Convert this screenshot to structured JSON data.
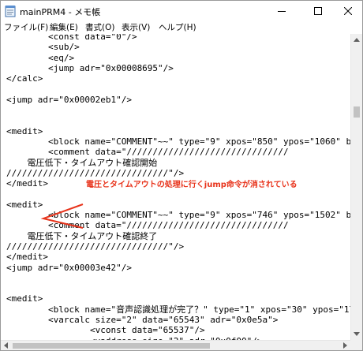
{
  "window": {
    "title": "mainPRM4 - メモ帳"
  },
  "title_buttons": {
    "minimize_icon": "minimize-icon",
    "maximize_icon": "maximize-icon",
    "close_icon": "close-icon"
  },
  "menu": {
    "items": [
      {
        "label": "ファイル(F)"
      },
      {
        "label": "編集(E)"
      },
      {
        "label": "書式(O)"
      },
      {
        "label": "表示(V)"
      },
      {
        "label": "ヘルプ(H)"
      }
    ]
  },
  "editor": {
    "content": "        <const data=\"0\"/>\n        <sub/>\n        <eq/>\n        <jump adr=\"0x00008695\"/>\n</calc>\n\n<jump adr=\"0x00002eb1\"/>\n\n\n<medit>\n        <block name=\"COMMENT\"~~\" type=\"9\" xpos=\"850\" ypos=\"1060\" bluearrow\n        <comment data=\"///////////////////////////////\n    電圧低下・タイムアウト確認開始\n///////////////////////////////\"/>\n</medit>\n\n<medit>\n        <block name=\"COMMENT\"~~\" type=\"9\" xpos=\"746\" ypos=\"1502\" bluearro\n        <comment data=\"///////////////////////////////\n    電圧低下・タイムアウト確認終了\n///////////////////////////////\"/>\n</medit>\n<jump adr=\"0x00003e42\"/>\n\n\n<medit>\n        <block name=\"音声認識処理が完了？\" type=\"1\" xpos=\"30\" ypos=\"1700\"\n        <varcalc size=\"2\" data=\"65543\" adr=\"0x0e5a\">\n                <vconst data=\"65537\"/>\n                <vaddress size=\"2\" adr=\"0x0f00\"/>\n                <flagconst data=\"1\"/>"
  },
  "annotation": {
    "text": "電圧とタイムアウトの処理に行くjump命令が消されている",
    "color": "#e8341c"
  }
}
